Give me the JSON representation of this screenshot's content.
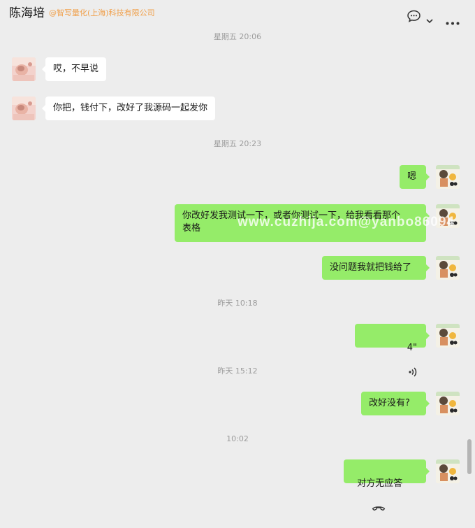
{
  "header": {
    "contact_name": "陈海培",
    "contact_org": "@智写量化(上海)科技有限公司"
  },
  "timestamps": [
    "星期五 20:06",
    "星期五 20:23",
    "昨天 10:18",
    "昨天 15:12",
    "10:02"
  ],
  "messages": [
    {
      "side": "left",
      "text": "哎，不早说"
    },
    {
      "side": "left",
      "text": "你把，钱付下，改好了我源码一起发你"
    },
    {
      "side": "right",
      "text": "嗯"
    },
    {
      "side": "right",
      "text": "你改好发我测试一下，或者你测试一下，给我看看那个\n表格"
    },
    {
      "side": "right",
      "text": "没问题我就把钱给了"
    },
    {
      "side": "right",
      "type": "voice",
      "duration": "4\""
    },
    {
      "side": "right",
      "text": "改好没有?"
    },
    {
      "side": "right",
      "type": "call",
      "text": "对方无应答"
    }
  ],
  "watermark": "www.cuzhija.com@yanbo86094",
  "icons": {
    "chat_icon": "chat-bubble-icon",
    "dropdown_icon": "chevron-down-icon",
    "more_icon": "more-icon",
    "voice_icon": "voice-wave-icon",
    "call_icon": "phone-hangup-icon"
  },
  "colors": {
    "sent_bubble": "#95ec69",
    "received_bubble": "#ffffff",
    "org_text": "#f0a04b",
    "background": "#ededed"
  }
}
